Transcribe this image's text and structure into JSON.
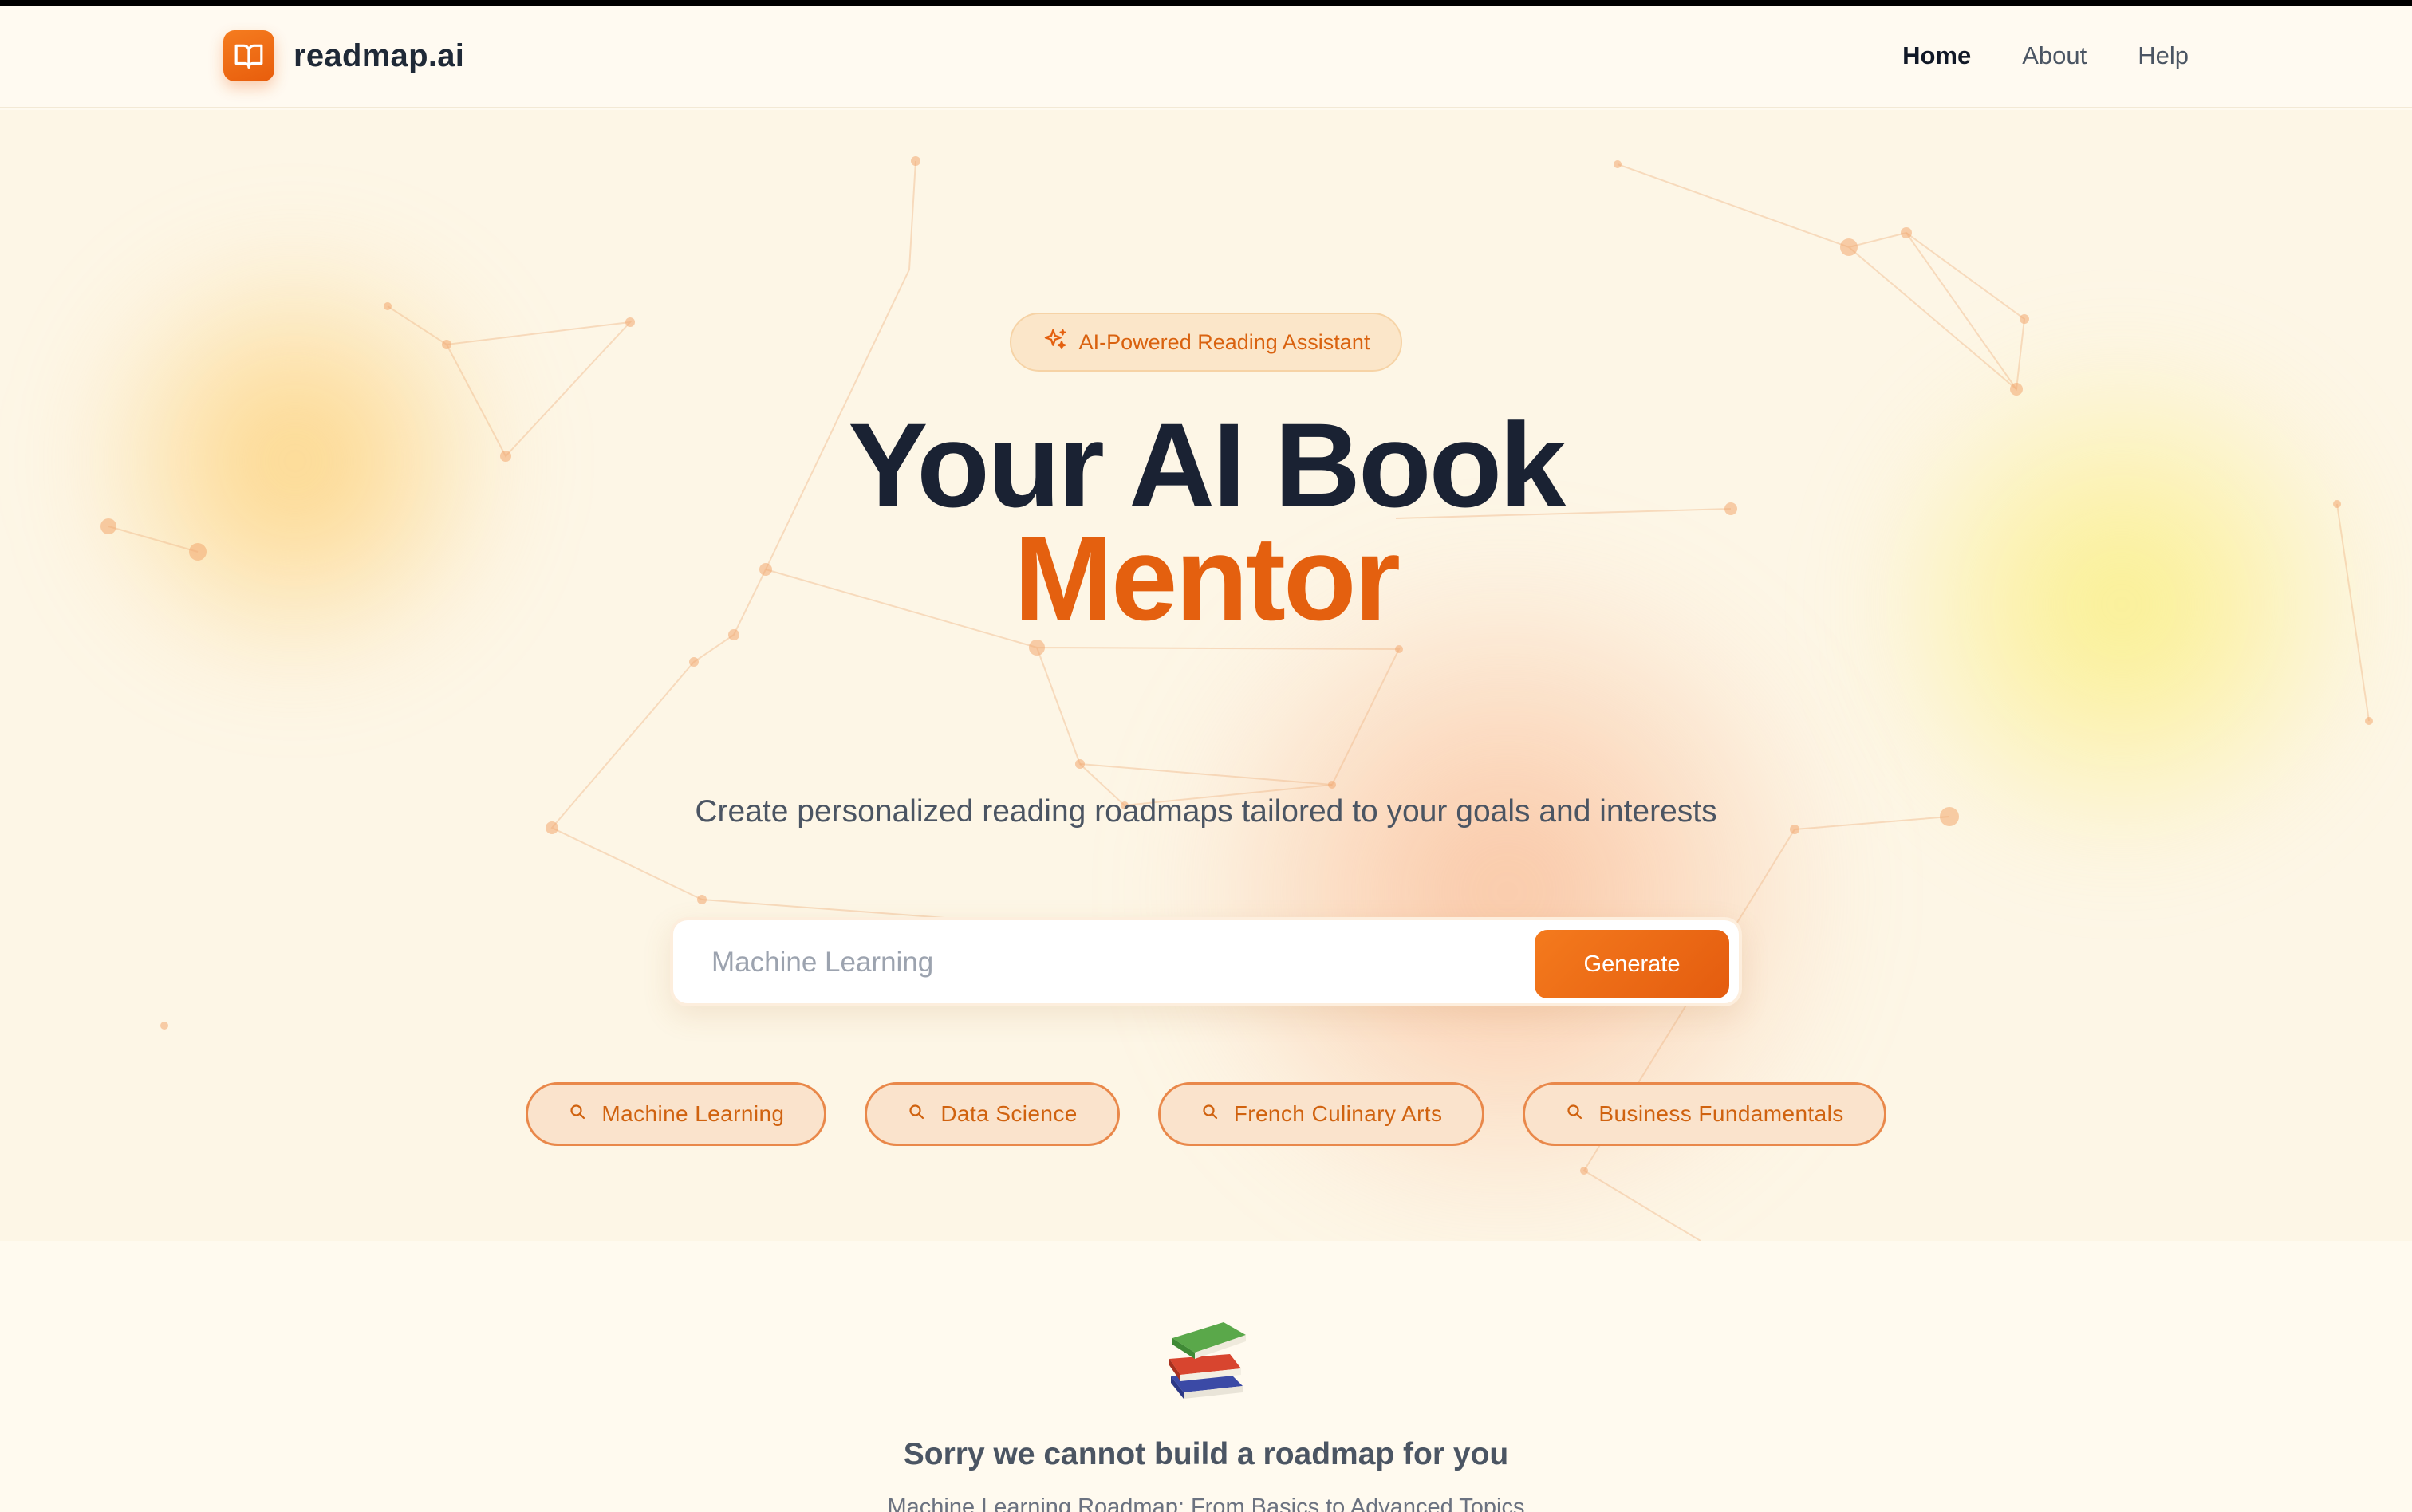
{
  "app": {
    "name": "readmap.ai"
  },
  "nav": {
    "links": [
      {
        "label": "Home",
        "active": true
      },
      {
        "label": "About",
        "active": false
      },
      {
        "label": "Help",
        "active": false
      }
    ]
  },
  "hero": {
    "badge": {
      "icon": "sparkle-icon",
      "label": "AI-Powered Reading Assistant"
    },
    "title_line1": "Your AI Book",
    "title_line2": "Mentor",
    "subtitle": "Create personalized reading roadmaps tailored to your goals and interests",
    "search": {
      "placeholder": "Machine Learning",
      "value": "",
      "button_label": "Generate"
    },
    "suggestions": [
      {
        "icon": "search-icon",
        "label": "Machine Learning"
      },
      {
        "icon": "search-icon",
        "label": "Data Science"
      },
      {
        "icon": "search-icon",
        "label": "French Culinary Arts"
      },
      {
        "icon": "search-icon",
        "label": "Business Fundamentals"
      }
    ]
  },
  "result": {
    "icon": "books-icon",
    "message": "Sorry we cannot build a roadmap for you",
    "roadmap_title": "Machine Learning Roadmap: From Basics to Advanced Topics"
  },
  "colors": {
    "accent": "#e4600f",
    "heading": "#1a2233",
    "background": "#fdf6e6"
  }
}
